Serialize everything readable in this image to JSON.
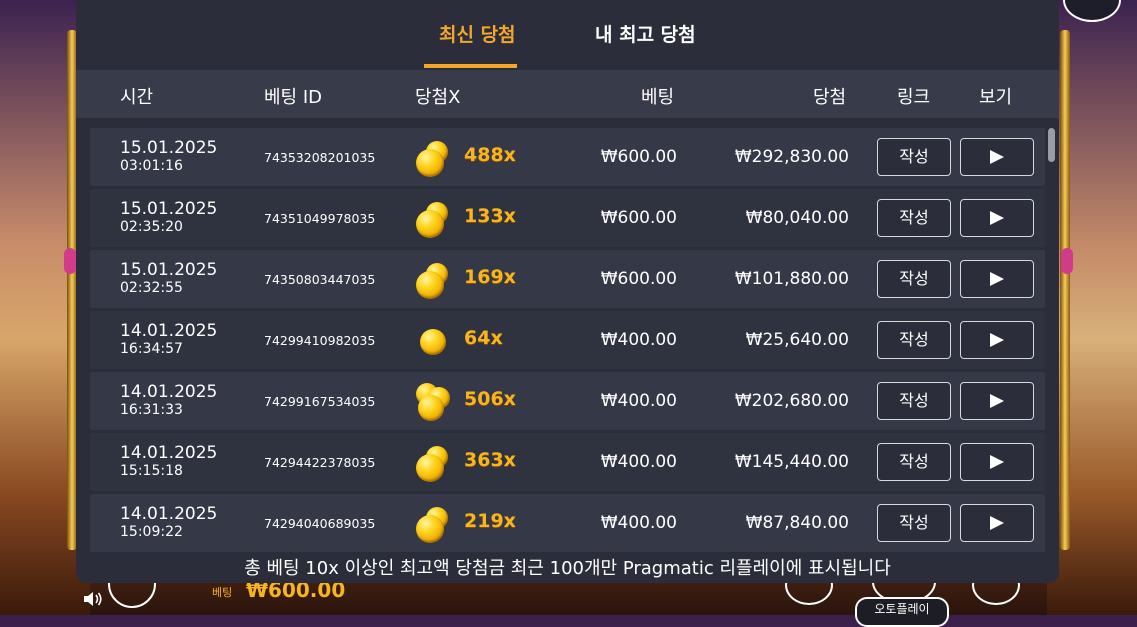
{
  "tabs": [
    {
      "label": "최신 당첨",
      "active": true
    },
    {
      "label": "내 최고 당첨",
      "active": false
    }
  ],
  "columns": {
    "time": "시간",
    "bet_id": "베팅 ID",
    "multiplier": "당첨X",
    "bet": "베팅",
    "win": "당첨",
    "link": "링크",
    "view": "보기"
  },
  "rows": [
    {
      "date": "15.01.2025",
      "time": "03:01:16",
      "bet_id": "74353208201035",
      "coins": 2,
      "multiplier": "488x",
      "bet": "₩600.00",
      "win": "₩292,830.00",
      "link_label": "작성"
    },
    {
      "date": "15.01.2025",
      "time": "02:35:20",
      "bet_id": "74351049978035",
      "coins": 2,
      "multiplier": "133x",
      "bet": "₩600.00",
      "win": "₩80,040.00",
      "link_label": "작성"
    },
    {
      "date": "15.01.2025",
      "time": "02:32:55",
      "bet_id": "74350803447035",
      "coins": 2,
      "multiplier": "169x",
      "bet": "₩600.00",
      "win": "₩101,880.00",
      "link_label": "작성"
    },
    {
      "date": "14.01.2025",
      "time": "16:34:57",
      "bet_id": "74299410982035",
      "coins": 1,
      "multiplier": "64x",
      "bet": "₩400.00",
      "win": "₩25,640.00",
      "link_label": "작성"
    },
    {
      "date": "14.01.2025",
      "time": "16:31:33",
      "bet_id": "74299167534035",
      "coins": 3,
      "multiplier": "506x",
      "bet": "₩400.00",
      "win": "₩202,680.00",
      "link_label": "작성"
    },
    {
      "date": "14.01.2025",
      "time": "15:15:18",
      "bet_id": "74294422378035",
      "coins": 2,
      "multiplier": "363x",
      "bet": "₩400.00",
      "win": "₩145,440.00",
      "link_label": "작성"
    },
    {
      "date": "14.01.2025",
      "time": "15:09:22",
      "bet_id": "74294040689035",
      "coins": 2,
      "multiplier": "219x",
      "bet": "₩400.00",
      "win": "₩87,840.00",
      "link_label": "작성"
    }
  ],
  "footer_note": "총 베팅 10x 이상인 최고액 당첨금 최근 100개만 Pragmatic 리플레이에 표시됩니다",
  "game_bar": {
    "bet_label": "베팅",
    "bet_amount": "₩600.00",
    "autoplay_label": "오토플레이"
  },
  "colors": {
    "accent": "#f4a62a",
    "panel_bg": "#2b2e3a",
    "header_bg": "#383b49",
    "multiplier": "#f7b51f"
  }
}
